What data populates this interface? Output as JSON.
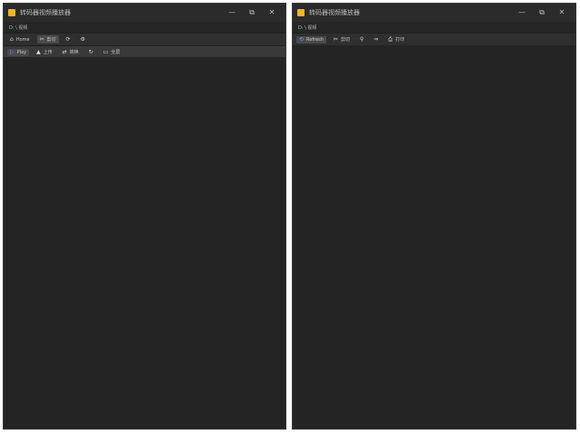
{
  "windows": [
    {
      "title": "转码器视频播放器",
      "path": "D: \\ 视频",
      "controls": {
        "minimize": "—",
        "restore": "⧉",
        "close": "✕"
      },
      "toolbar1": [
        {
          "icon": "⌂",
          "label": "Home",
          "active": false
        },
        {
          "icon": "✂",
          "label": "剪切",
          "active": true
        },
        {
          "icon": "⟳",
          "label": "",
          "active": false
        },
        {
          "icon": "⚙",
          "label": "",
          "active": false
        }
      ],
      "toolbar2": [
        {
          "icon": "▷",
          "label": "Play",
          "active": true
        },
        {
          "icon": "▲",
          "label": "上传",
          "active": false
        },
        {
          "icon": "⇄",
          "label": "转换",
          "active": false
        },
        {
          "icon": "↻",
          "label": "",
          "active": false
        },
        {
          "icon": "▭",
          "label": "全屏",
          "active": false
        }
      ]
    },
    {
      "title": "转码器视频播放器",
      "path": "D: \\ 视频",
      "controls": {
        "minimize": "—",
        "restore": "⧉",
        "close": "✕"
      },
      "toolbar1": [
        {
          "icon": "⟲",
          "label": "Refresh",
          "active": true
        },
        {
          "icon": "✂",
          "label": "剪切",
          "active": false
        },
        {
          "icon": "⚲",
          "label": "",
          "active": false
        },
        {
          "icon": "⇒",
          "label": "",
          "active": false
        },
        {
          "icon": "⎙",
          "label": "打印",
          "active": false
        }
      ]
    }
  ]
}
